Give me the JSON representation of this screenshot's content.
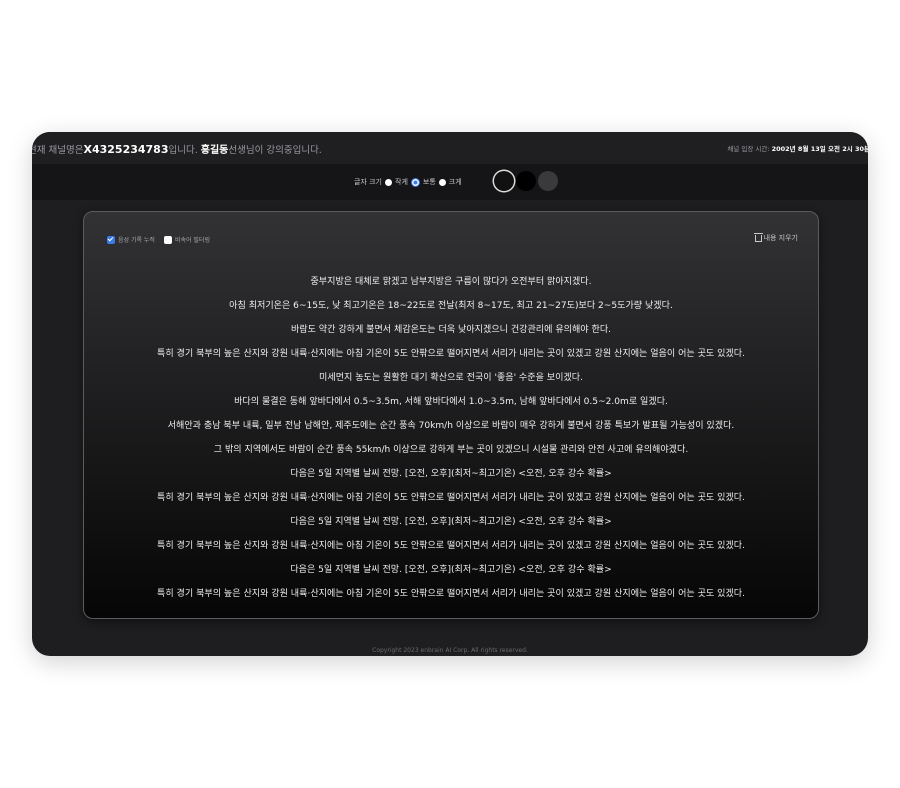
{
  "header": {
    "channel_prefix": "현재 채널명은",
    "channel_id": "X4325234783",
    "channel_suffix": "입니다.",
    "instructor": "홍길동",
    "instructor_suffix": "선생님이 강의중입니다.",
    "entry_label": "채널 입장 시간:",
    "entry_time": "2002년 8월 13일 오전 2시 30분"
  },
  "toolbar": {
    "font_size_label": "글자 크기",
    "options": [
      "작게",
      "보통",
      "크게"
    ],
    "selected": "보통",
    "themes": [
      "#111111",
      "#000000",
      "#3a3a3c"
    ]
  },
  "panel": {
    "voice_accumulate_label": "음성 기록 누적",
    "voice_accumulate_checked": true,
    "profanity_filter_label": "비속어 필터링",
    "profanity_filter_checked": false,
    "clear_label": "내용 지우기",
    "lines": [
      "중부지방은 대체로 맑겠고 남부지방은 구름이 많다가 오전부터 맑아지겠다.",
      "아침 최저기온은 6~15도, 낮 최고기온은 18~22도로 전날(최저 8~17도, 최고 21~27도)보다 2~5도가량 낮겠다.",
      "바람도 약간 강하게 불면서 체감온도는 더욱 낮아지겠으니 건강관리에 유의해야 한다.",
      "특히 경기 북부의 높은 산지와 강원 내륙·산지에는 아침 기온이 5도 안팎으로 떨어지면서 서리가 내리는 곳이 있겠고 강원 산지에는 얼음이 어는 곳도 있겠다.",
      "미세먼지 농도는 원활한 대기 확산으로 전국이 '좋음' 수준을 보이겠다.",
      "바다의 물결은 동해 앞바다에서 0.5~3.5m, 서해 앞바다에서 1.0~3.5m, 남해 앞바다에서 0.5~2.0m로 일겠다.",
      "서해안과 충남 북부 내륙, 일부 전남 남해안, 제주도에는 순간 풍속 70km/h 이상으로 바람이 매우 강하게 불면서 강풍 특보가 발표될 가능성이 있겠다.",
      "그 밖의 지역에서도 바람이 순간 풍속 55km/h 이상으로 강하게 부는 곳이 있겠으니 시설물 관리와 안전 사고에 유의해야겠다.",
      "다음은 5일 지역별 날씨 전망. [오전, 오후](최저~최고기온) <오전, 오후 강수 확률>",
      "특히 경기 북부의 높은 산지와 강원 내륙·산지에는 아침 기온이 5도 안팎으로 떨어지면서 서리가 내리는 곳이 있겠고 강원 산지에는 얼음이 어는 곳도 있겠다.",
      "다음은 5일 지역별 날씨 전망. [오전, 오후](최저~최고기온) <오전, 오후 강수 확률>",
      "특히 경기 북부의 높은 산지와 강원 내륙·산지에는 아침 기온이 5도 안팎으로 떨어지면서 서리가 내리는 곳이 있겠고 강원 산지에는 얼음이 어는 곳도 있겠다.",
      "다음은 5일 지역별 날씨 전망. [오전, 오후](최저~최고기온) <오전, 오후 강수 확률>",
      "특히 경기 북부의 높은 산지와 강원 내륙·산지에는 아침 기온이 5도 안팎으로 떨어지면서 서리가 내리는 곳이 있겠고 강원 산지에는 얼음이 어는 곳도 있겠다."
    ]
  },
  "footer": {
    "copyright": "Copyright 2023 enbrain AI Corp. All rights reserved."
  }
}
